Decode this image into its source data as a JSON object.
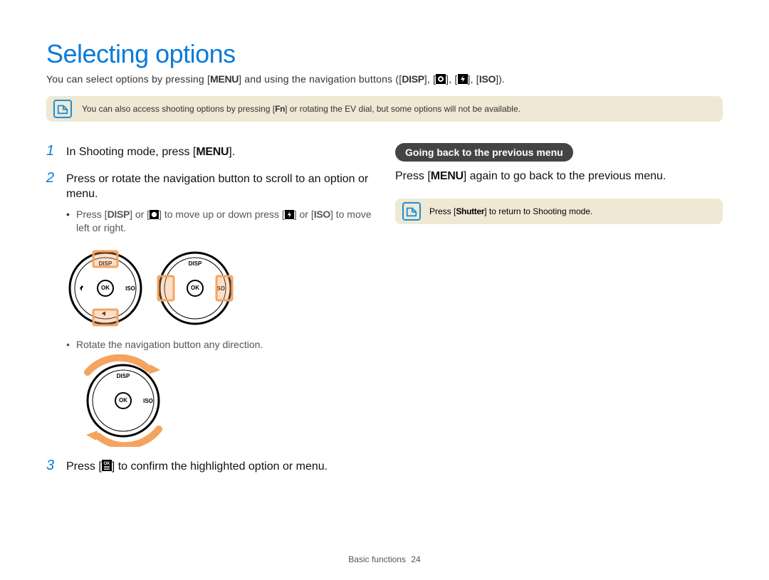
{
  "title": "Selecting options",
  "intro_parts": {
    "a": "You can select options by pressing [",
    "menu": "MENU",
    "b": "] and using the navigation buttons ([",
    "disp": "DISP",
    "c": "], [",
    "d": "], [",
    "e": "], [",
    "iso": "ISO",
    "f": "])."
  },
  "buttons": {
    "menu": "MENU",
    "fn": "Fn",
    "disp": "DISP",
    "iso": "ISO",
    "shutter": "Shutter",
    "ok": "OK"
  },
  "note_top": {
    "a": "You can also access shooting options by pressing [",
    "b": "] or rotating the EV dial, but some options will not be available."
  },
  "steps": {
    "s1": {
      "num": "1",
      "a": "In Shooting mode, press [",
      "b": "]."
    },
    "s2": {
      "num": "2",
      "text": "Press or rotate the navigation button to scroll to an option or menu.",
      "sub1": {
        "a": "Press [",
        "b": "] or [",
        "c": "] to move up or down press [",
        "d": "] or [",
        "e": "] to move left or right."
      },
      "sub2": "Rotate the navigation button any direction."
    },
    "s3": {
      "num": "3",
      "a": "Press [",
      "b": "] to confirm the highlighted option or menu."
    }
  },
  "right": {
    "heading": "Going back to the previous menu",
    "line": {
      "a": "Press [",
      "b": "] again to go back to the previous menu."
    },
    "note": {
      "a": "Press [",
      "b": "] to return to Shooting mode."
    }
  },
  "dial": {
    "top": "DISP",
    "right": "ISO",
    "center": "OK"
  },
  "footer": {
    "section": "Basic functions",
    "page": "24"
  }
}
